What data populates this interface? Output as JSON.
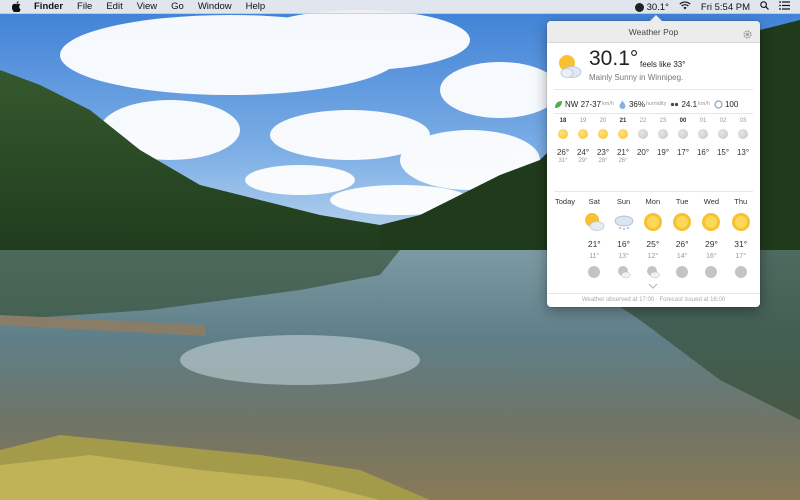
{
  "menubar": {
    "app_name": "Finder",
    "menus": [
      "File",
      "Edit",
      "View",
      "Go",
      "Window",
      "Help"
    ],
    "status_temp": "30.1°",
    "clock": "Fri 5:54 PM",
    "icons": [
      "apple-icon",
      "wifi-icon",
      "spotlight-search-icon",
      "notification-center-icon"
    ]
  },
  "popover": {
    "title": "Weather Pop",
    "current": {
      "temp": "30.1°",
      "feels": "feels like 33°",
      "description": "Mainly Sunny in Winnipeg."
    },
    "conditions": {
      "wind_dir": "NW",
      "wind_speed": "27-37",
      "wind_unit": "km/h",
      "humidity": "36%",
      "humidity_label": "humidity",
      "visibility": "24.1",
      "visibility_unit": "km/h",
      "pressure": "100"
    },
    "hourly": [
      {
        "hour": "18",
        "bold": true,
        "icon": "sun",
        "temp": "26°",
        "feels": "31°"
      },
      {
        "hour": "19",
        "bold": false,
        "icon": "sun",
        "temp": "24°",
        "feels": "29°"
      },
      {
        "hour": "20",
        "bold": false,
        "icon": "sun",
        "temp": "23°",
        "feels": "28°"
      },
      {
        "hour": "21",
        "bold": true,
        "icon": "sun",
        "temp": "21°",
        "feels": "26°"
      },
      {
        "hour": "22",
        "bold": false,
        "icon": "moon",
        "temp": "20°",
        "feels": ""
      },
      {
        "hour": "23",
        "bold": false,
        "icon": "moon",
        "temp": "19°",
        "feels": ""
      },
      {
        "hour": "00",
        "bold": true,
        "icon": "moon",
        "temp": "17°",
        "feels": ""
      },
      {
        "hour": "01",
        "bold": false,
        "icon": "moon",
        "temp": "16°",
        "feels": ""
      },
      {
        "hour": "02",
        "bold": false,
        "icon": "moon",
        "temp": "15°",
        "feels": ""
      },
      {
        "hour": "03",
        "bold": false,
        "icon": "moon",
        "temp": "13°",
        "feels": ""
      }
    ],
    "daily": [
      {
        "day": "Today",
        "icon": "none",
        "hi": "",
        "lo": "",
        "night_icon": "none"
      },
      {
        "day": "Sat",
        "icon": "sun-cloud",
        "hi": "21°",
        "lo": "11°",
        "night_icon": "moon"
      },
      {
        "day": "Sun",
        "icon": "cloud-snow",
        "hi": "16°",
        "lo": "13°",
        "night_icon": "moon-cloud"
      },
      {
        "day": "Mon",
        "icon": "sun",
        "hi": "25°",
        "lo": "12°",
        "night_icon": "moon-cloud"
      },
      {
        "day": "Tue",
        "icon": "sun",
        "hi": "26°",
        "lo": "14°",
        "night_icon": "moon"
      },
      {
        "day": "Wed",
        "icon": "sun",
        "hi": "29°",
        "lo": "16°",
        "night_icon": "moon"
      },
      {
        "day": "Thu",
        "icon": "sun",
        "hi": "31°",
        "lo": "17°",
        "night_icon": "moon"
      }
    ],
    "footer": "Weather observed at 17:00 · Forecast issued at 16:00",
    "colors": {
      "sun": "#f6c232",
      "moon": "#c4c4c4",
      "header": "#ececec"
    }
  }
}
